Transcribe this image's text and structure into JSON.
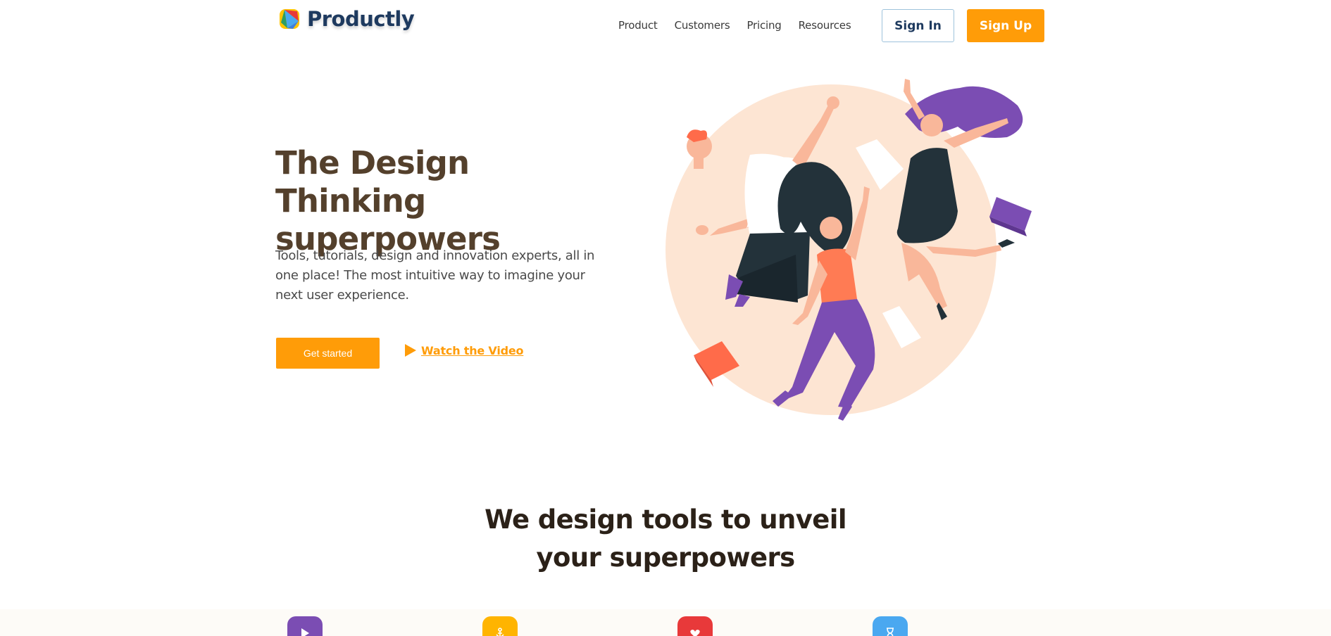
{
  "header": {
    "logo_text": "Productly",
    "nav": [
      "Product",
      "Customers",
      "Pricing",
      "Resources"
    ],
    "sign_in": "Sign In",
    "sign_up": "Sign Up"
  },
  "hero": {
    "title_line1": "The Design Thinking",
    "title_line2": "superpowers",
    "subtitle": "Tools, tutorials, design and innovation experts, all in one place! The most intuitive way to imagine your next user experience.",
    "cta": "Get started",
    "watch": "Watch the Video"
  },
  "section": {
    "title_line1": "We design tools to unveil",
    "title_line2": "your superpowers"
  },
  "features": [
    {
      "icon": "play-icon",
      "color": "#7b4db3"
    },
    {
      "icon": "anchor-icon",
      "color": "#ffb400"
    },
    {
      "icon": "heart-icon",
      "color": "#e8393a"
    },
    {
      "icon": "hourglass-icon",
      "color": "#4aa8f0"
    }
  ],
  "colors": {
    "accent": "#ff9c08",
    "heading": "#54402c",
    "logo": "#1e3a5f"
  }
}
